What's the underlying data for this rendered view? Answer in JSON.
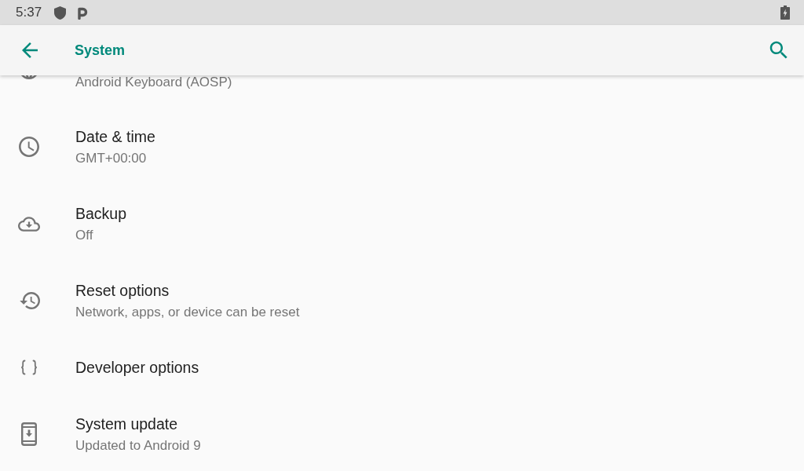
{
  "status_bar": {
    "time": "5:37"
  },
  "app_bar": {
    "title": "System"
  },
  "list": {
    "scrolled_item": {
      "summary": "Android Keyboard (AOSP)"
    },
    "items": [
      {
        "title": "Date & time",
        "summary": "GMT+00:00"
      },
      {
        "title": "Backup",
        "summary": "Off"
      },
      {
        "title": "Reset options",
        "summary": "Network, apps, or device can be reset"
      },
      {
        "title": "Developer options"
      },
      {
        "title": "System update",
        "summary": "Updated to Android 9"
      }
    ]
  }
}
